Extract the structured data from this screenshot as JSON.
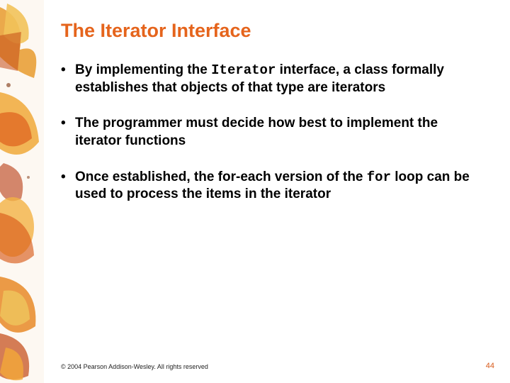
{
  "title": "The Iterator Interface",
  "bullets": [
    {
      "pre": "By implementing the ",
      "code": "Iterator",
      "post": " interface, a class formally establishes that objects of that type are iterators"
    },
    {
      "pre": "The programmer must decide how best to implement the iterator functions",
      "code": "",
      "post": ""
    },
    {
      "pre": "Once established, the for-each version of the ",
      "code": "for",
      "post": " loop can be used to process the items in the iterator"
    }
  ],
  "footer": {
    "copyright": "© 2004 Pearson Addison-Wesley. All rights reserved",
    "page": "44"
  }
}
